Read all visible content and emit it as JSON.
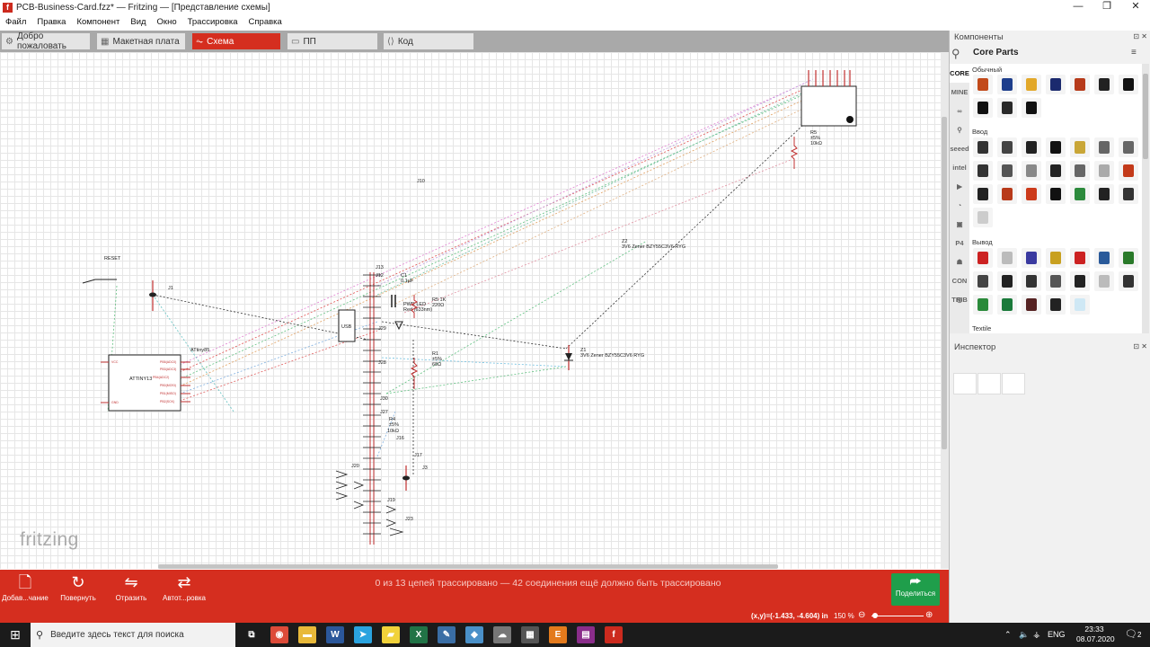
{
  "window": {
    "title": "PCB-Business-Card.fzz* — Fritzing — [Представление схемы]",
    "app_icon_letter": "f",
    "controls": [
      "—",
      "❐",
      "✕"
    ]
  },
  "menu": [
    "Файл",
    "Правка",
    "Компонент",
    "Вид",
    "Окно",
    "Трассировка",
    "Справка"
  ],
  "tabs": [
    {
      "label": "Добро пожаловать",
      "icon": "⚙"
    },
    {
      "label": "Макетная плата",
      "icon": "▦"
    },
    {
      "label": "Схема",
      "icon": "⏦",
      "active": true
    },
    {
      "label": "ПП",
      "icon": "▭"
    },
    {
      "label": "Код",
      "icon": "⟨⟩"
    }
  ],
  "schematic": {
    "watermark": "fritzing",
    "labels": {
      "reset": "RESET",
      "j1": "J1",
      "j10": "J10",
      "j12": "J12",
      "j13": "J13",
      "c1": "C1",
      "c1v": "0.1µF",
      "usb": "USB",
      "r5k": "R5 1K",
      "r5kv": "220Ω",
      "pwr": "PWR LED",
      "pwr2": "Red (633nm)",
      "j29": "J29",
      "j28": "J28",
      "j30": "J30",
      "j27": "J27",
      "r1": "R1",
      "r1a": "±5%",
      "r1b": "68Ω",
      "r4": "R4",
      "r4a": "±5%",
      "r4b": "10kΩ",
      "j16": "J16",
      "j17": "J17",
      "j3": "J3",
      "j20": "J20",
      "j19": "J19",
      "j23": "J23",
      "attiny": "ATtiny85",
      "attiny_body": "ATTINY13",
      "pins": [
        "PB5(ADC0)",
        "PB3(ADC3)",
        "PB4(ADC2)",
        "PB0(MOSI)",
        "PB1(MISO)",
        "PB2(SCK)",
        "VCC",
        "GND"
      ],
      "r5": "R5",
      "r5a": "±5%",
      "r5b": "10kΩ",
      "z2": "Z2",
      "z2v": "3V6 Zener BZY55C3V6 RYG",
      "z1": "Z1",
      "z1v": "3V6 Zener BZY55C3V6 RYG"
    }
  },
  "toolbar": {
    "tools": [
      {
        "label": "Добав...чание",
        "icon": "🗋"
      },
      {
        "label": "Повернуть",
        "icon": "↻"
      },
      {
        "label": "Отразить",
        "icon": "⇋"
      },
      {
        "label": "Автот...ровка",
        "icon": "⇄"
      }
    ],
    "routing_status": "0 из 13 цепей трассировано — 42 соединения ещё должно быть трассировано",
    "share_label": "Поделиться",
    "share_icon": "⮫"
  },
  "statusbar": {
    "coords": "(x,y)=(-1.433, -4.604) in",
    "zoom": "150 %",
    "zoom_minus": "⊖",
    "zoom_plus": "⊕"
  },
  "components_panel": {
    "header": "Компоненты",
    "bin_title": "Core Parts",
    "bin_menu": "≡",
    "bin_tabs": [
      "CORE",
      "MINE",
      "∞",
      "⚲",
      "seeed",
      "intel",
      "▶",
      "◔",
      "▣",
      "P4",
      "☗",
      "CON TRIB",
      "◎"
    ],
    "sections": [
      "Обычный",
      "Ввод",
      "Вывод",
      "Textile"
    ],
    "common_colors": [
      "#c24a1a",
      "#1e3e8c",
      "#e2a82a",
      "#1b2a6e",
      "#b63a1a",
      "#222222",
      "#111111",
      "#111111",
      "#2a2a2a",
      "#111111"
    ],
    "input_colors": [
      "#333333",
      "#444444",
      "#222222",
      "#111111",
      "#c9a637",
      "#666666",
      "#666666",
      "#333333",
      "#555555",
      "#888888",
      "#222222",
      "#666666",
      "#aaaaaa",
      "#c33a1a",
      "#222222",
      "#b83a1a",
      "#cc3a1a",
      "#111111",
      "#2c8a3c",
      "#222222",
      "#333333",
      "#cccccc"
    ],
    "output_colors": [
      "#cc2222",
      "#bbbbbb",
      "#3a3aa0",
      "#c8a020",
      "#cc2222",
      "#2a5a9a",
      "#2a7a2a",
      "#444444",
      "#222222",
      "#333333",
      "#555555",
      "#222222",
      "#bbbbbb",
      "#333333",
      "#2a8a3a",
      "#1a7a3a",
      "#552222",
      "#222222",
      "#cfe8f5"
    ]
  },
  "inspector": {
    "header": "Инспектор",
    "controls": "⊡ ✕"
  },
  "taskbar": {
    "search_placeholder": "Введите здесь текст для поиска",
    "lang": "ENG",
    "time": "23:33",
    "date": "08.07.2020",
    "notif_count": "2",
    "apps": [
      {
        "name": "task-view",
        "color": "#1b1b1b",
        "glyph": "⧉"
      },
      {
        "name": "chrome",
        "color": "#dd4b39",
        "glyph": "◉"
      },
      {
        "name": "explorer",
        "color": "#e8b93a",
        "glyph": "▬"
      },
      {
        "name": "word",
        "color": "#2b579a",
        "glyph": "W"
      },
      {
        "name": "telegram",
        "color": "#2aa3df",
        "glyph": "➤"
      },
      {
        "name": "sticky",
        "color": "#f1d23a",
        "glyph": "▰"
      },
      {
        "name": "excel",
        "color": "#217346",
        "glyph": "X"
      },
      {
        "name": "notepad",
        "color": "#3a6ea5",
        "glyph": "✎"
      },
      {
        "name": "app-blue",
        "color": "#4a90c8",
        "glyph": "◆"
      },
      {
        "name": "app-gray",
        "color": "#777777",
        "glyph": "☁"
      },
      {
        "name": "calculator",
        "color": "#555555",
        "glyph": "▦"
      },
      {
        "name": "app-orange",
        "color": "#e37a1c",
        "glyph": "E"
      },
      {
        "name": "winrar",
        "color": "#8a2d8a",
        "glyph": "▤"
      },
      {
        "name": "fritzing",
        "color": "#cc2a1e",
        "glyph": "f"
      }
    ]
  }
}
